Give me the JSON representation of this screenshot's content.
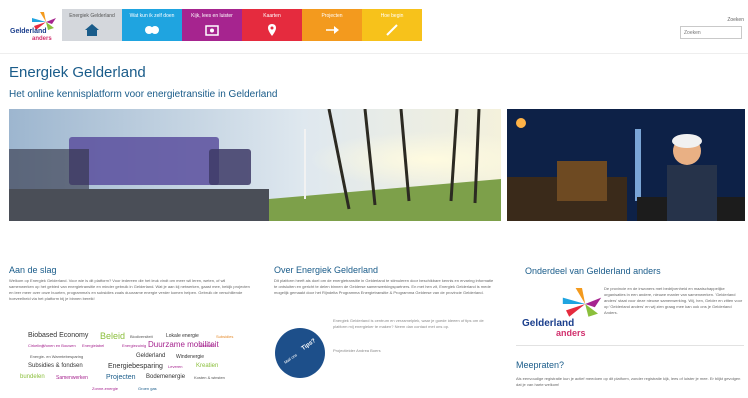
{
  "logo": {
    "word1": "Gelderland",
    "word2": "anders"
  },
  "nav": [
    {
      "label": "Energiek Gelderland",
      "color": "#d4d7dc",
      "icon": "home-icon"
    },
    {
      "label": "Wat kun ik zelf doen",
      "color": "#1fa4e0",
      "icon": "people-icon"
    },
    {
      "label": "Kijk, lees en luister",
      "color": "#a6248f",
      "icon": "media-icon"
    },
    {
      "label": "Kaarten",
      "color": "#e52b3e",
      "icon": "map-pin-icon"
    },
    {
      "label": "Projecten",
      "color": "#f39a1e",
      "icon": "arrow-icon"
    },
    {
      "label": "Hoe begin",
      "color": "#f7c21b",
      "icon": "pencil-icon"
    }
  ],
  "search": {
    "label": "Zoeken",
    "placeholder": "Zoeken"
  },
  "header": {
    "title": "Energiek Gelderland",
    "subtitle": "Het online kennisplatform voor energietransitie in Gelderland"
  },
  "aan_de_slag": {
    "title": "Aan de slag",
    "intro": "Welkom op Energiek Gelderland. Voor wie is dit platform? Voor iedereen die het leuk vindt om meer wil leren, weten, of wil samenwerken op het gebied van energietransitie en minder gebruik in Gelderland. Wat je aan kij netwerken, gaast mee, bekijk projecten en leer meer over onze buurten, programma's en subsidies zoals duurzame energie verder komen helpen. Gebruik de verschillende hoeveelheid via het platform bij je binnen bereik!"
  },
  "tag_cloud": [
    {
      "text": "Biobased Economy",
      "size": 7,
      "color": "#333333"
    },
    {
      "text": "Beleid",
      "size": 9,
      "color": "#8bbf3c"
    },
    {
      "text": "Biodiversiteit",
      "size": 4,
      "color": "#555555"
    },
    {
      "text": "Lokale energie",
      "size": 5,
      "color": "#333333"
    },
    {
      "text": "Subsidies",
      "size": 4,
      "color": "#e58a2a"
    },
    {
      "text": "Cirkeling",
      "size": 4,
      "color": "#a6248f"
    },
    {
      "text": "Wonen en Bouwen",
      "size": 4,
      "color": "#a6248f"
    },
    {
      "text": "Energielabel",
      "size": 4,
      "color": "#a6248f"
    },
    {
      "text": "Energiezuinig",
      "size": 4,
      "color": "#a6248f"
    },
    {
      "text": "Duurzame mobiliteit",
      "size": 8,
      "color": "#a6248f"
    },
    {
      "text": "Bronnen",
      "size": 4,
      "color": "#a6248f"
    },
    {
      "text": "Energie- en Warmtebesparing",
      "size": 4,
      "color": "#555555"
    },
    {
      "text": "Gelderland",
      "size": 6,
      "color": "#333333"
    },
    {
      "text": "Windenergie",
      "size": 5,
      "color": "#333333"
    },
    {
      "text": "Subsidies & fondsen",
      "size": 6,
      "color": "#333333"
    },
    {
      "text": "Energiebesparing",
      "size": 7,
      "color": "#333333"
    },
    {
      "text": "Leveren",
      "size": 4,
      "color": "#a6248f"
    },
    {
      "text": "Kreatien",
      "size": 6,
      "color": "#8bbf3c"
    },
    {
      "text": "bundelen",
      "size": 6,
      "color": "#8bbf3c"
    },
    {
      "text": "Samenwerken",
      "size": 5,
      "color": "#a6248f"
    },
    {
      "text": "Projecten",
      "size": 7,
      "color": "#1a5c8a"
    },
    {
      "text": "Bodemenergie",
      "size": 6,
      "color": "#333333"
    },
    {
      "text": "Kosten & winsten",
      "size": 4,
      "color": "#555555"
    },
    {
      "text": "Zonne-energie",
      "size": 4,
      "color": "#a6248f"
    },
    {
      "text": "Groen gas",
      "size": 4,
      "color": "#1a5c8a"
    }
  ],
  "over": {
    "title": "Over Energiek Gelderland",
    "body": "Dit platform heeft als doel om de energietransitie in Gelderland te stimuleren door beschikbare kennis en ervaring informatie te ontsluiten en gericht te delen binnen de Gelderse samenwerkingspartners. En met hen zit, Energiek Gelderland is mede mogelijk gemaakt door het Rijndelta Programma Energietransitie & Programma Gelderse van de provincie Gelderland.",
    "quote": "Energiek Gelderland is centrum en verzamelplek, waar je goede ideeen of tips om de platform mij energieker te maken? Neem dan contact met ons op.",
    "quote_author": "Projectleider Andrea Boers",
    "circle_label": "Tips?",
    "circle_sub": "Mail ons"
  },
  "onderdeel": {
    "title": "Onderdeel van Gelderland anders",
    "body": "De provincie en de inwoners met bedrijvenheid en maatschappelijke organisaties in een andere, nieuwe manier van samenwerken. 'Gelderland anders' staat voor deze nieuwe samenwerking. Wij, hen, Gelder en zitten voor op 'Gelderland anders' en wij zien graag mee kan ook ons je Gelderland Anders.",
    "logo_word1": "Gelderland",
    "logo_word2": "anders"
  },
  "meepraten": {
    "title": "Meepraten?",
    "body": "Als eenvoudige registratie kun je actief meedoen op dit platform, zonder registratie kijk, lees of luister je mee. Er blijkt gevolgen dat je van harte welkom!"
  }
}
